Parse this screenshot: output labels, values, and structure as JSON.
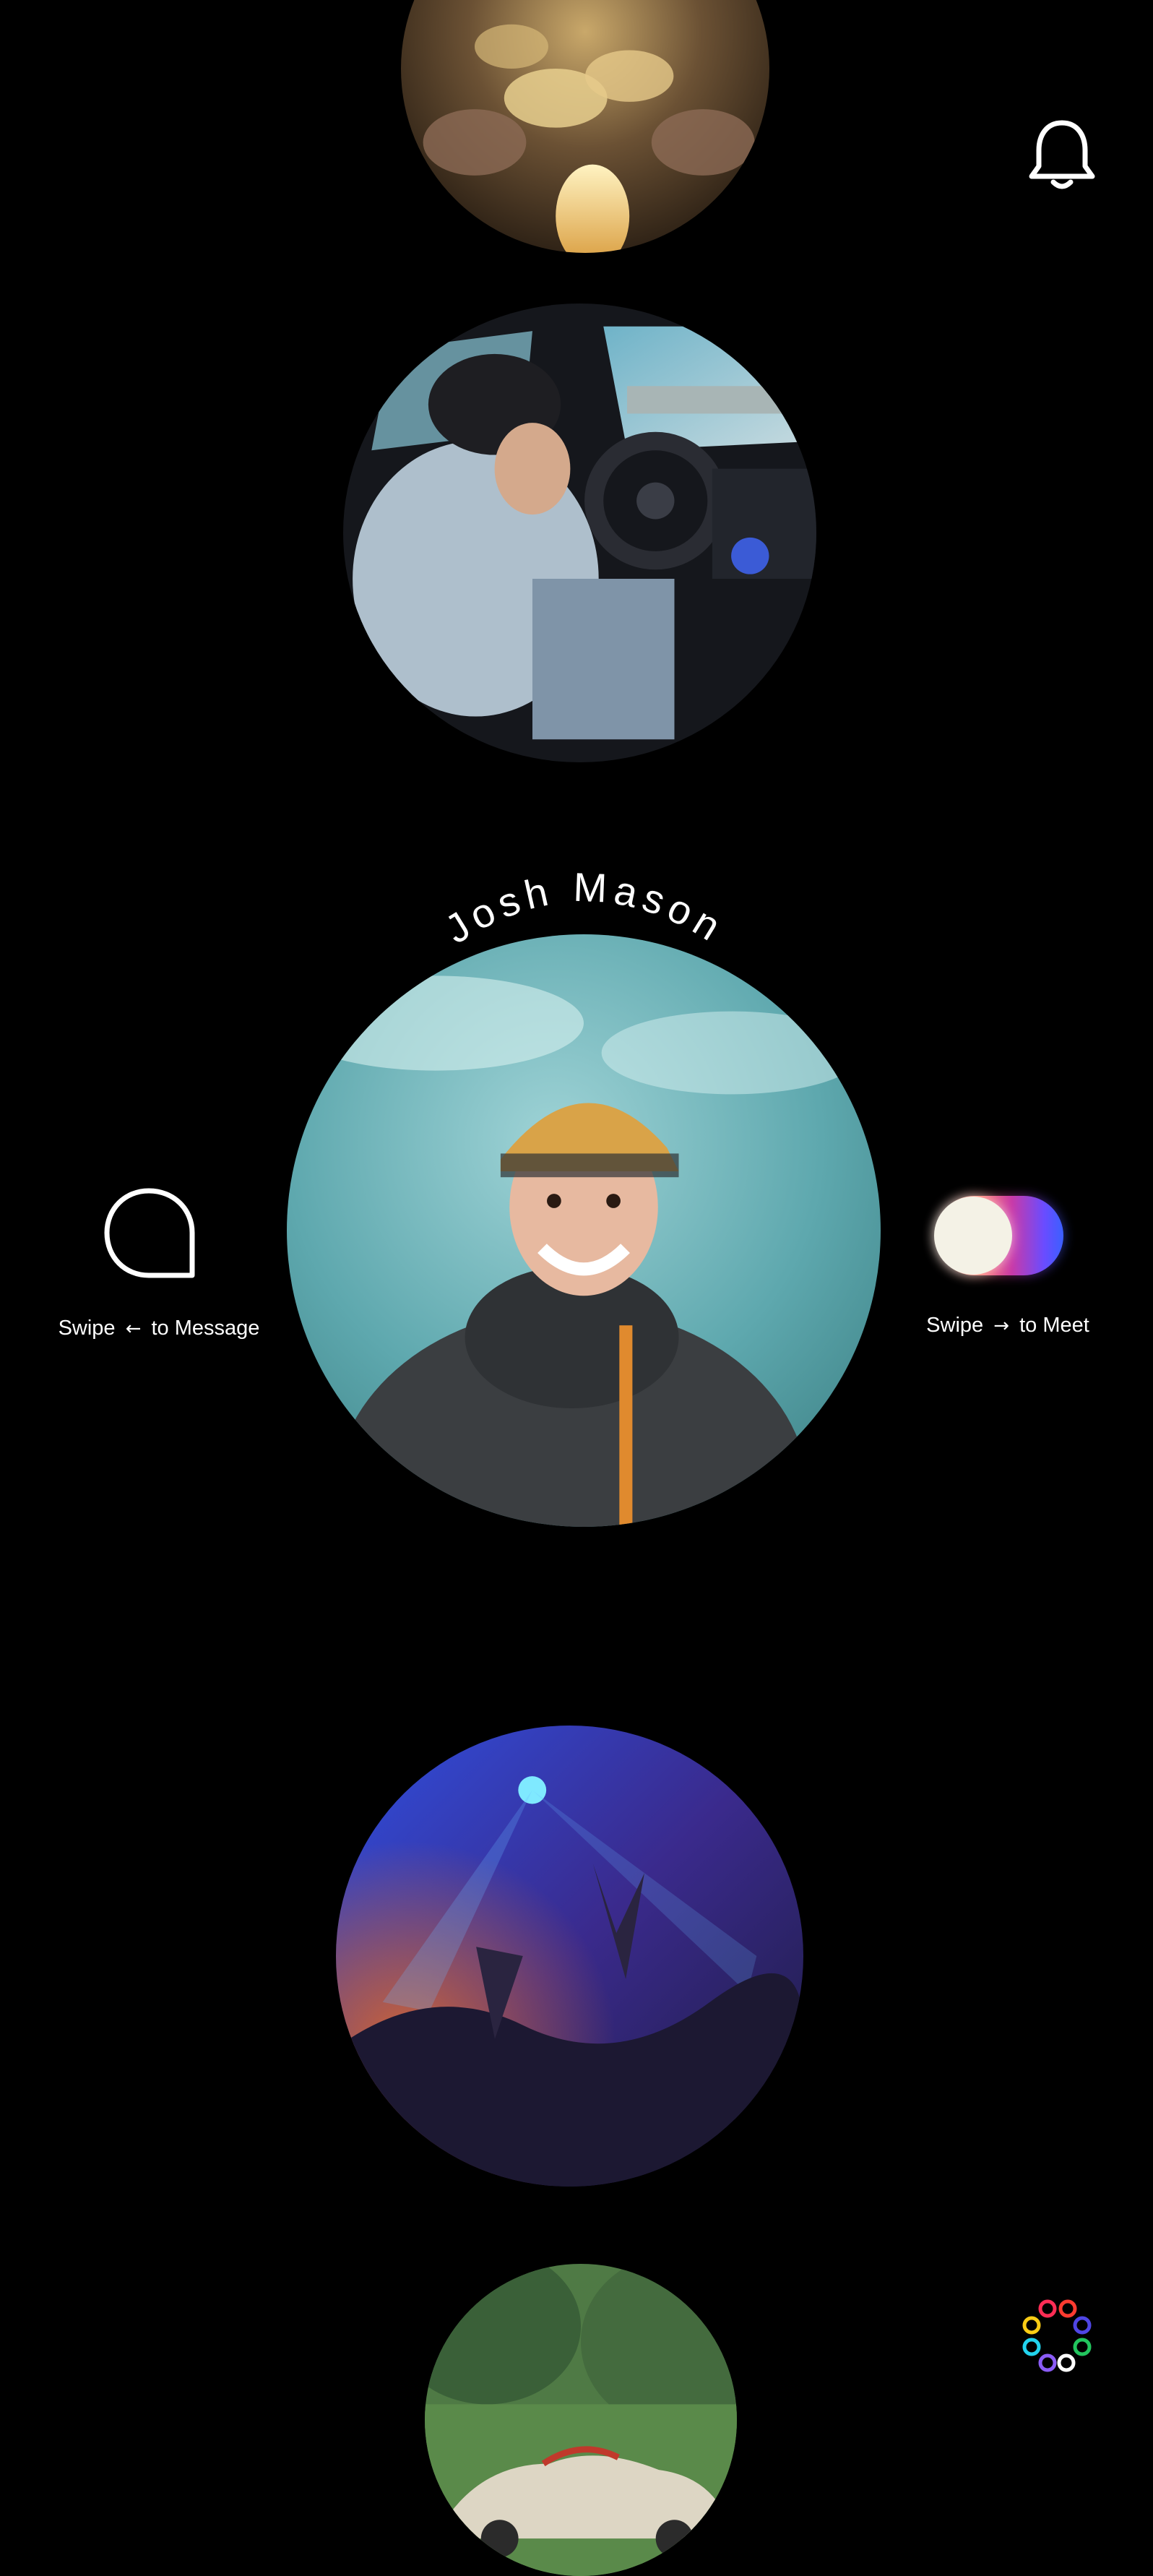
{
  "profile": {
    "name": "Josh Mason",
    "photos": [
      "wine-glasses-toast",
      "driving-car",
      "portrait",
      "concert-crowd",
      "vintage-car"
    ]
  },
  "actions": {
    "message": {
      "label_prefix": "Swipe",
      "arrow": "←",
      "label_suffix": "to Message"
    },
    "meet": {
      "label_prefix": "Swipe",
      "arrow": "→",
      "label_suffix": "to Meet"
    }
  },
  "icons": {
    "notifications": "bell-icon",
    "message": "speech-bubble-icon",
    "meet": "gradient-toggle-icon",
    "menu": "color-ring-icon"
  },
  "colors": {
    "background": "#000000",
    "text": "#ffffff",
    "ring": [
      "#ff2d55",
      "#ff3b30",
      "#4f46e5",
      "#22c55e",
      "#ffffff",
      "#8b5cf6",
      "#22d3ee",
      "#facc15"
    ]
  }
}
